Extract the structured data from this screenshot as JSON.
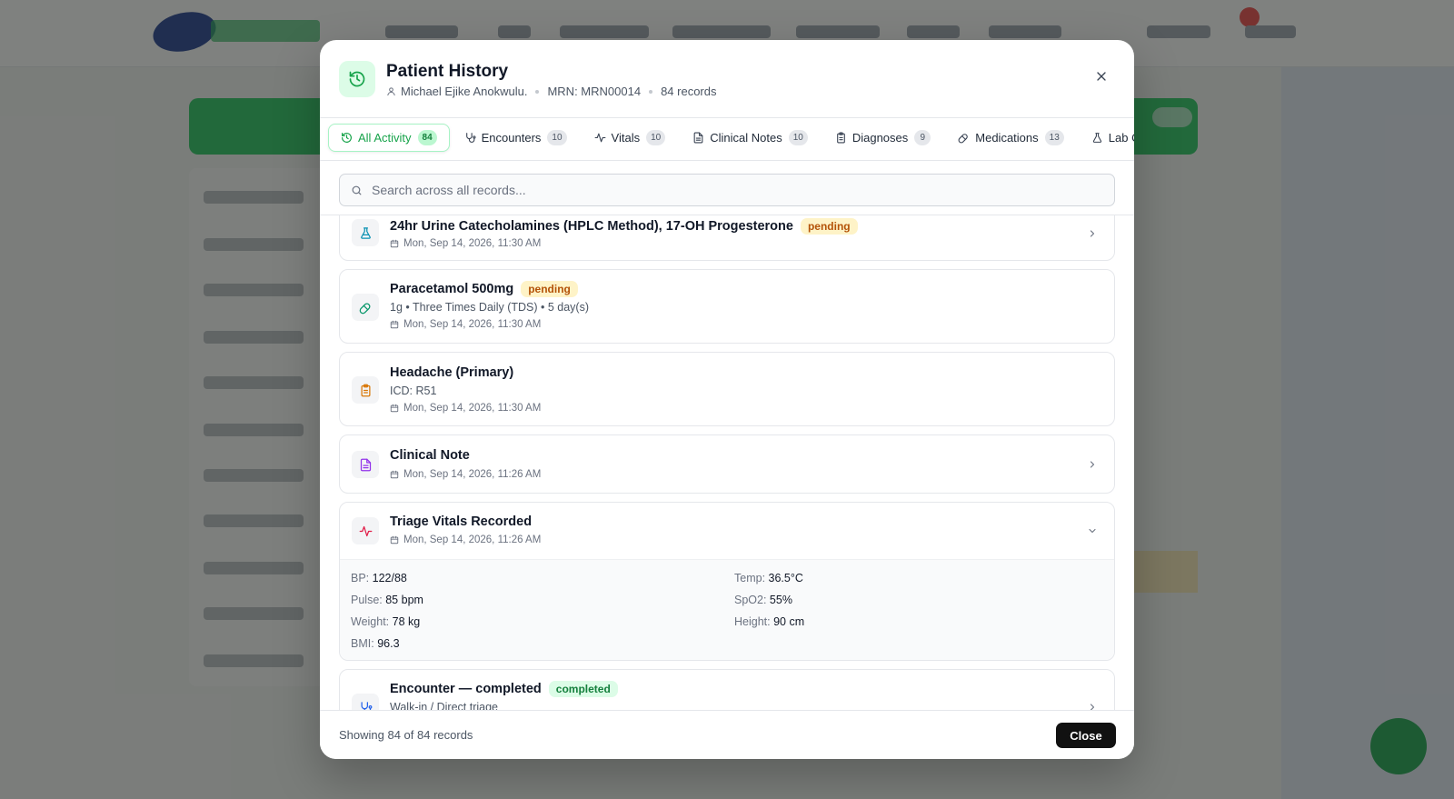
{
  "modal": {
    "title": "Patient History",
    "patient_name": "Michael Ejike Anokwulu.",
    "mrn": "MRN: MRN00014",
    "record_count": "84 records",
    "close_icon": "x-icon",
    "header_icon": "history-icon",
    "accent_color": "#16a34a"
  },
  "tabs": [
    {
      "label": "All Activity",
      "count": "84",
      "icon": "history-icon",
      "active": true
    },
    {
      "label": "Encounters",
      "count": "10",
      "icon": "stethoscope-icon"
    },
    {
      "label": "Vitals",
      "count": "10",
      "icon": "activity-icon"
    },
    {
      "label": "Clinical Notes",
      "count": "10",
      "icon": "file-text-icon"
    },
    {
      "label": "Diagnoses",
      "count": "9",
      "icon": "clipboard-icon"
    },
    {
      "label": "Medications",
      "count": "13",
      "icon": "pill-icon"
    },
    {
      "label": "Lab Orders",
      "icon": "flask-icon"
    }
  ],
  "search": {
    "placeholder": "Search across all records..."
  },
  "records": [
    {
      "type": "lab",
      "icon": "flask-icon",
      "title": "24hr Urine Catecholamines (HPLC Method), 17-OH Progesterone",
      "badge": "pending",
      "date": "Mon, Sep 14, 2026, 11:30 AM"
    },
    {
      "type": "medication",
      "icon": "pill-icon",
      "title": "Paracetamol 500mg",
      "badge": "pending",
      "detail": "1g • Three Times Daily (TDS) • 5 day(s)",
      "date": "Mon, Sep 14, 2026, 11:30 AM"
    },
    {
      "type": "diagnosis",
      "icon": "clipboard-icon",
      "title": "Headache (Primary)",
      "detail": "ICD: R51",
      "date": "Mon, Sep 14, 2026, 11:30 AM"
    },
    {
      "type": "note",
      "icon": "file-text-icon",
      "title": "Clinical Note",
      "date": "Mon, Sep 14, 2026, 11:26 AM"
    },
    {
      "type": "vitals",
      "icon": "activity-icon",
      "title": "Triage Vitals Recorded",
      "date": "Mon, Sep 14, 2026, 11:26 AM",
      "expanded": true,
      "vitals": {
        "bp_label": "BP:",
        "bp": "122/88",
        "temp_label": "Temp:",
        "temp": "36.5°C",
        "pulse_label": "Pulse:",
        "pulse": "85 bpm",
        "spo2_label": "SpO2:",
        "spo2": "55%",
        "weight_label": "Weight:",
        "weight": "78 kg",
        "height_label": "Height:",
        "height": "90 cm",
        "bmi_label": "BMI:",
        "bmi": "96.3"
      }
    },
    {
      "type": "encounter",
      "icon": "stethoscope-icon",
      "title": "Encounter — completed",
      "badge": "completed",
      "detail": "Walk-in / Direct triage"
    }
  ],
  "footer": {
    "summary": "Showing 84 of 84 records",
    "close_label": "Close"
  }
}
